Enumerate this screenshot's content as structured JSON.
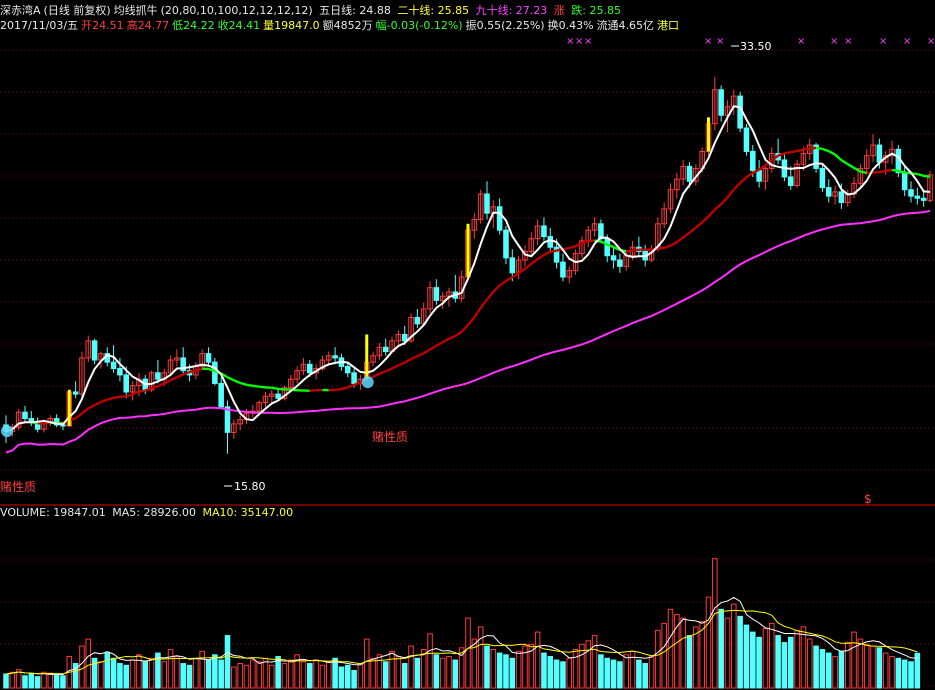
{
  "header": {
    "stock_name": "深赤湾A",
    "mode": "(日线 前复权)",
    "indicator": "均线抓牛",
    "params": "(20,80,10,100,12,12,12,12)",
    "ma5_label": "五日线: 24.88",
    "ma20_label": "二十线: 25.85",
    "ma90_label": "九十线: 27.23",
    "up_label": "涨",
    "down_label": "跌: 25.85"
  },
  "quote": {
    "date": "2017/11/03/五",
    "open": "开24.51",
    "high": "高24.77",
    "low": "低24.22",
    "close": "收24.41",
    "volume": "量19847.0",
    "amount": "额4852万",
    "change": "幅-0.03(-0.12%)",
    "amplitude": "振0.55(2.25%)",
    "turnover": "换0.43%",
    "float_cap": "流通4.65亿",
    "sector": "港口"
  },
  "volume_header": {
    "volume": "VOLUME: 19847.01",
    "ma5": "MA5: 28926.00",
    "ma10": "MA10: 35147.00"
  },
  "annotations": {
    "high_price": "33.50",
    "low_price": "15.80",
    "signal_text": "赌性质",
    "dollar_mark": "$",
    "x_mark": "×"
  },
  "colors": {
    "background": "#000000",
    "up_candle": "#ff3b3b",
    "down_candle": "#54ffff",
    "ma5": "#ffffff",
    "ma20_red": "#c00000",
    "ma20_green": "#00ff00",
    "ma90": "#ff30ff",
    "signal_bar": "#ffff00",
    "grid": "#8b0000",
    "divider": "#b00000"
  },
  "chart_data": {
    "type": "candlestick",
    "title": "深赤湾A (日线 前复权) 均线抓牛",
    "price_range": [
      14.0,
      35.0
    ],
    "volume_range": [
      0,
      95000
    ],
    "annotations": {
      "high": 33.5,
      "low": 15.8
    },
    "candles": [
      [
        17.15,
        17.6,
        16.3,
        16.85
      ],
      [
        16.85,
        17.2,
        16.6,
        17.05
      ],
      [
        17.05,
        17.9,
        16.9,
        17.75
      ],
      [
        17.75,
        18.05,
        17.3,
        17.45
      ],
      [
        17.45,
        17.8,
        17.1,
        17.3
      ],
      [
        17.3,
        17.5,
        16.8,
        16.95
      ],
      [
        16.95,
        17.4,
        16.8,
        17.25
      ],
      [
        17.25,
        17.6,
        17.1,
        17.45
      ],
      [
        17.45,
        17.65,
        17.05,
        17.15
      ],
      [
        17.15,
        17.3,
        16.9,
        17.1
      ],
      [
        17.1,
        18.8,
        17.1,
        18.7
      ],
      [
        18.7,
        19.2,
        18.4,
        18.6
      ],
      [
        18.6,
        20.6,
        18.3,
        20.3
      ],
      [
        20.3,
        21.35,
        20.1,
        21.1
      ],
      [
        21.1,
        21.2,
        20.0,
        20.2
      ],
      [
        20.2,
        20.6,
        19.8,
        20.5
      ],
      [
        20.5,
        20.8,
        19.9,
        20.1
      ],
      [
        20.1,
        20.9,
        19.6,
        19.8
      ],
      [
        19.8,
        20.3,
        19.2,
        19.5
      ],
      [
        19.5,
        19.9,
        18.4,
        18.7
      ],
      [
        18.7,
        19.2,
        18.3,
        19.0
      ],
      [
        19.0,
        19.6,
        18.5,
        19.3
      ],
      [
        19.3,
        19.5,
        18.6,
        18.8
      ],
      [
        18.8,
        19.7,
        18.7,
        19.6
      ],
      [
        19.6,
        20.2,
        19.1,
        19.3
      ],
      [
        19.3,
        19.8,
        19.0,
        19.6
      ],
      [
        19.6,
        20.4,
        19.5,
        20.2
      ],
      [
        20.2,
        20.7,
        19.9,
        20.3
      ],
      [
        20.3,
        20.8,
        19.5,
        19.7
      ],
      [
        19.7,
        20.0,
        19.2,
        19.5
      ],
      [
        19.5,
        20.1,
        19.3,
        19.9
      ],
      [
        19.9,
        20.7,
        19.8,
        20.5
      ],
      [
        20.5,
        20.8,
        19.9,
        20.1
      ],
      [
        20.1,
        20.3,
        19.0,
        19.1
      ],
      [
        19.1,
        19.4,
        17.9,
        18.0
      ],
      [
        18.0,
        18.3,
        15.8,
        16.8
      ],
      [
        16.8,
        17.4,
        16.5,
        17.2
      ],
      [
        17.2,
        17.6,
        16.9,
        17.4
      ],
      [
        17.4,
        17.9,
        17.2,
        17.7
      ],
      [
        17.7,
        18.1,
        17.5,
        17.8
      ],
      [
        17.8,
        18.3,
        17.6,
        18.2
      ],
      [
        18.2,
        18.7,
        18.0,
        18.5
      ],
      [
        18.5,
        18.8,
        18.2,
        18.6
      ],
      [
        18.6,
        18.9,
        18.3,
        18.4
      ],
      [
        18.4,
        19.0,
        18.3,
        18.9
      ],
      [
        18.9,
        19.5,
        18.7,
        19.3
      ],
      [
        19.3,
        19.9,
        19.1,
        19.7
      ],
      [
        19.7,
        20.3,
        19.5,
        20.0
      ],
      [
        20.0,
        20.2,
        19.4,
        19.6
      ],
      [
        19.6,
        20.0,
        19.3,
        19.8
      ],
      [
        19.8,
        20.4,
        19.7,
        20.2
      ],
      [
        20.2,
        20.6,
        20.0,
        20.4
      ],
      [
        20.4,
        20.8,
        20.1,
        20.3
      ],
      [
        20.3,
        20.5,
        19.7,
        19.9
      ],
      [
        19.9,
        20.1,
        19.4,
        19.6
      ],
      [
        19.6,
        19.8,
        18.9,
        19.1
      ],
      [
        19.1,
        19.5,
        18.8,
        19.3
      ],
      [
        19.3,
        21.4,
        19.2,
        20.1
      ],
      [
        20.1,
        20.6,
        19.9,
        20.4
      ],
      [
        20.4,
        21.0,
        20.2,
        20.8
      ],
      [
        20.8,
        21.2,
        20.4,
        20.6
      ],
      [
        20.6,
        21.3,
        20.5,
        21.1
      ],
      [
        21.1,
        21.6,
        20.9,
        21.4
      ],
      [
        21.4,
        21.8,
        20.9,
        21.1
      ],
      [
        21.1,
        22.4,
        21.0,
        22.2
      ],
      [
        22.2,
        22.6,
        21.7,
        21.9
      ],
      [
        21.9,
        22.9,
        21.8,
        22.6
      ],
      [
        22.6,
        23.9,
        22.4,
        23.6
      ],
      [
        23.6,
        24.0,
        22.8,
        23.0
      ],
      [
        23.0,
        23.4,
        22.6,
        23.2
      ],
      [
        23.2,
        23.6,
        22.7,
        23.4
      ],
      [
        23.4,
        24.2,
        22.9,
        23.1
      ],
      [
        23.1,
        24.4,
        22.9,
        24.1
      ],
      [
        24.1,
        26.6,
        24.0,
        26.3
      ],
      [
        26.3,
        27.1,
        25.9,
        26.8
      ],
      [
        26.8,
        28.2,
        26.6,
        28.0
      ],
      [
        28.0,
        28.6,
        26.8,
        27.1
      ],
      [
        27.1,
        27.7,
        26.4,
        27.4
      ],
      [
        27.4,
        27.8,
        26.1,
        26.3
      ],
      [
        26.3,
        26.5,
        24.7,
        25.0
      ],
      [
        25.0,
        25.4,
        23.9,
        24.3
      ],
      [
        24.3,
        25.1,
        24.0,
        24.9
      ],
      [
        24.9,
        25.6,
        24.6,
        25.3
      ],
      [
        25.3,
        26.2,
        25.1,
        25.9
      ],
      [
        25.9,
        26.8,
        25.6,
        26.5
      ],
      [
        26.5,
        26.9,
        25.8,
        26.0
      ],
      [
        26.0,
        26.4,
        25.3,
        25.5
      ],
      [
        25.5,
        25.9,
        24.5,
        24.8
      ],
      [
        24.8,
        25.2,
        23.9,
        24.1
      ],
      [
        24.1,
        24.6,
        23.8,
        24.4
      ],
      [
        24.4,
        25.4,
        24.2,
        25.2
      ],
      [
        25.2,
        26.0,
        25.0,
        25.8
      ],
      [
        25.8,
        26.5,
        25.5,
        26.3
      ],
      [
        26.3,
        26.9,
        26.0,
        26.6
      ],
      [
        26.6,
        26.8,
        25.7,
        25.9
      ],
      [
        25.9,
        26.1,
        24.8,
        25.1
      ],
      [
        25.1,
        25.5,
        24.5,
        24.9
      ],
      [
        24.9,
        25.2,
        24.3,
        24.6
      ],
      [
        24.6,
        25.3,
        24.4,
        25.1
      ],
      [
        25.1,
        25.8,
        24.9,
        25.5
      ],
      [
        25.5,
        26.0,
        25.1,
        25.3
      ],
      [
        25.3,
        25.6,
        24.6,
        24.9
      ],
      [
        24.9,
        25.6,
        24.8,
        25.4
      ],
      [
        25.4,
        26.9,
        25.3,
        26.6
      ],
      [
        26.6,
        27.6,
        26.4,
        27.3
      ],
      [
        27.3,
        28.5,
        27.1,
        28.2
      ],
      [
        28.2,
        29.0,
        27.8,
        28.7
      ],
      [
        28.7,
        29.6,
        28.4,
        29.3
      ],
      [
        29.3,
        29.5,
        28.3,
        28.6
      ],
      [
        28.6,
        29.4,
        28.4,
        29.2
      ],
      [
        29.2,
        30.2,
        29.0,
        30.0
      ],
      [
        30.0,
        31.6,
        29.8,
        31.3
      ],
      [
        31.3,
        33.5,
        31.0,
        32.9
      ],
      [
        32.9,
        33.1,
        31.4,
        31.7
      ],
      [
        31.7,
        32.4,
        30.9,
        32.1
      ],
      [
        32.1,
        32.9,
        31.7,
        32.6
      ],
      [
        32.6,
        32.8,
        30.9,
        31.1
      ],
      [
        31.1,
        31.3,
        29.8,
        30.0
      ],
      [
        30.0,
        30.3,
        28.8,
        29.1
      ],
      [
        29.1,
        29.6,
        28.3,
        28.6
      ],
      [
        28.6,
        29.4,
        28.2,
        29.2
      ],
      [
        29.2,
        30.2,
        29.0,
        29.9
      ],
      [
        29.9,
        30.6,
        29.4,
        29.6
      ],
      [
        29.6,
        29.9,
        28.6,
        28.8
      ],
      [
        28.8,
        29.3,
        28.2,
        28.4
      ],
      [
        28.4,
        29.6,
        28.3,
        29.4
      ],
      [
        29.4,
        30.2,
        29.1,
        29.9
      ],
      [
        29.9,
        30.6,
        29.6,
        30.3
      ],
      [
        30.3,
        30.4,
        29.0,
        29.2
      ],
      [
        29.2,
        29.4,
        28.1,
        28.3
      ],
      [
        28.3,
        28.7,
        27.6,
        27.9
      ],
      [
        27.9,
        28.4,
        27.5,
        28.1
      ],
      [
        28.1,
        28.5,
        27.3,
        27.6
      ],
      [
        27.6,
        28.2,
        27.4,
        28.0
      ],
      [
        28.0,
        28.8,
        27.8,
        28.5
      ],
      [
        28.5,
        29.4,
        28.3,
        29.2
      ],
      [
        29.2,
        30.1,
        28.9,
        29.8
      ],
      [
        29.8,
        30.8,
        29.5,
        30.3
      ],
      [
        30.3,
        30.6,
        29.2,
        29.5
      ],
      [
        29.5,
        30.0,
        28.9,
        29.8
      ],
      [
        29.8,
        30.5,
        29.4,
        30.1
      ],
      [
        30.1,
        30.3,
        28.8,
        29.0
      ],
      [
        29.0,
        29.3,
        27.9,
        28.2
      ],
      [
        28.2,
        28.6,
        27.6,
        27.9
      ],
      [
        27.9,
        28.3,
        27.5,
        27.8
      ],
      [
        27.8,
        28.2,
        27.4,
        27.7
      ],
      [
        27.7,
        29.1,
        27.6,
        28.9
      ]
    ],
    "volume": [
      8000,
      9000,
      10500,
      7000,
      8000,
      6500,
      9000,
      8500,
      7500,
      7000,
      18000,
      14000,
      24000,
      28000,
      17000,
      15000,
      20000,
      17000,
      14000,
      13000,
      16000,
      19000,
      15000,
      17000,
      20000,
      15000,
      22000,
      18000,
      14000,
      13000,
      17000,
      21000,
      16000,
      19000,
      16000,
      30000,
      12000,
      14000,
      13000,
      16000,
      15000,
      17000,
      13000,
      18000,
      14000,
      16000,
      19000,
      15000,
      14000,
      16000,
      13000,
      15000,
      17000,
      12000,
      13000,
      10000,
      14000,
      28000,
      17000,
      19000,
      15000,
      21000,
      18000,
      14000,
      24000,
      17000,
      22000,
      31000,
      19000,
      17000,
      18000,
      16000,
      23000,
      40000,
      28000,
      35000,
      24000,
      22000,
      20000,
      19000,
      17000,
      21000,
      24000,
      25000,
      32000,
      20000,
      18000,
      16000,
      15000,
      17000,
      22000,
      25000,
      27000,
      30000,
      19000,
      17000,
      16000,
      15000,
      19000,
      21000,
      16000,
      14000,
      18000,
      33000,
      37000,
      45000,
      42000,
      40000,
      30000,
      35000,
      38000,
      52000,
      74000,
      45000,
      40000,
      48000,
      41000,
      36000,
      32000,
      29000,
      34000,
      37000,
      30000,
      26000,
      29000,
      33000,
      35000,
      28000,
      24000,
      22000,
      20000,
      18000,
      21000,
      26000,
      32000,
      28000,
      25000,
      24000,
      23000,
      20000,
      18000,
      17000,
      16000,
      15000,
      19847
    ],
    "volume_ma": {
      "ma5": 28926.0,
      "ma10": 35147.0,
      "last_volume": 19847.01
    }
  }
}
